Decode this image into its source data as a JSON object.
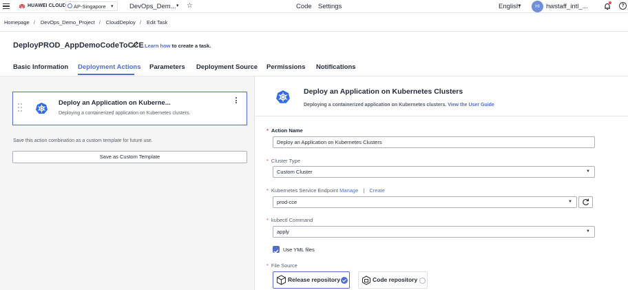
{
  "topbar": {
    "brand": "HUAWEI CLOUD",
    "region": "AP-Singapore",
    "project": "DevOps_Dem...",
    "nav": [
      "Code",
      "Settings"
    ],
    "language": "English",
    "avatar_initials": "HI",
    "username": "hwstaff_intl_..."
  },
  "breadcrumb": [
    "Homepage",
    "DevOps_Demo_Project",
    "CloudDeploy",
    "Edit Task"
  ],
  "task": {
    "title": "DeployPROD_AppDemoCodeToCCE",
    "learn_link": "Learn how",
    "learn_suffix": " to create a task."
  },
  "tabs": [
    {
      "label": "Basic Information",
      "active": false
    },
    {
      "label": "Deployment Actions",
      "active": true
    },
    {
      "label": "Parameters",
      "active": false
    },
    {
      "label": "Deployment Source",
      "active": false
    },
    {
      "label": "Permissions",
      "active": false
    },
    {
      "label": "Notifications",
      "active": false
    }
  ],
  "left": {
    "card_title": "Deploy an Application on Kuberne...",
    "card_desc": "Deploying a containerized application on Kubernetes clusters.",
    "save_hint": "Save this action combination as a custom template for future use.",
    "save_button": "Save as Custom Template"
  },
  "right": {
    "title": "Deploy an Application on Kubernetes Clusters",
    "desc": "Deploying a containerized application on Kubernetes clusters. ",
    "guide_link": "View the User Guide",
    "fields": {
      "action_name_label": "Action Name",
      "action_name_value": "Deploy an Application on Kubernetes Clusters",
      "cluster_type_label": "Cluster Type",
      "cluster_type_value": "Custom Cluster",
      "endpoint_label": "Kubernetes Service Endpoint",
      "manage_link": "Manage",
      "link_sep": "|",
      "create_link": "Create",
      "endpoint_value": "prod-cce",
      "kubectl_label": "kubectl Command",
      "kubectl_value": "apply",
      "use_yml_label": "Use YML files",
      "use_yml_checked": true,
      "file_source_label": "File Source",
      "release_repo": "Release repository",
      "code_repo": "Code repository",
      "selected_source": "Release repository"
    }
  },
  "colors": {
    "accent": "#526ecc",
    "required": "#e94a45",
    "brand": "#c7000b"
  },
  "icons": [
    "menu-icon",
    "huawei-logo-icon",
    "location-pin-icon",
    "chevron-down-icon",
    "star-icon",
    "bell-icon",
    "help-icon",
    "pencil-icon",
    "kubernetes-icon",
    "drag-handle-icon",
    "more-vertical-icon",
    "refresh-icon",
    "checkbox-icon",
    "package-icon",
    "repo-icon",
    "check-circle-icon"
  ]
}
